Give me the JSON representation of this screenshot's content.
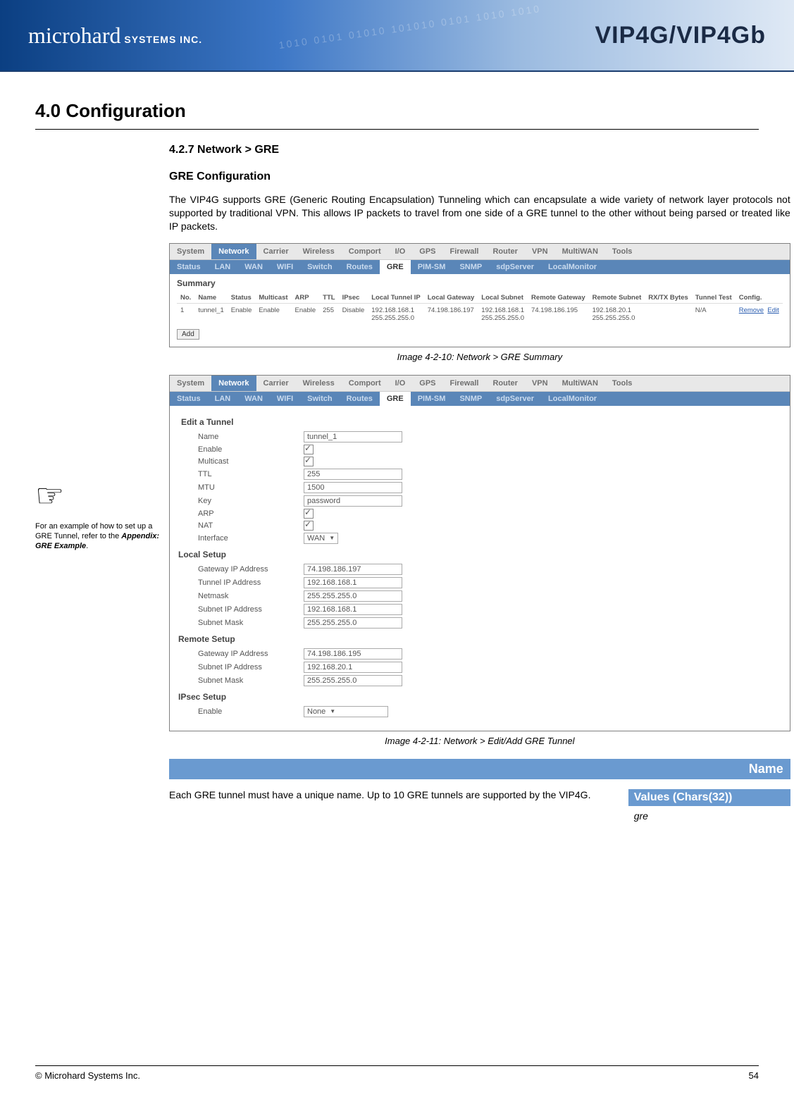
{
  "banner": {
    "brand_main": "microhard",
    "brand_sub": " SYSTEMS INC.",
    "product": "VIP4G/VIP4Gb"
  },
  "section": {
    "number_title": "4.0  Configuration",
    "subsection": "4.2.7 Network > GRE",
    "config_head": "GRE Configuration",
    "intro": "The VIP4G supports GRE (Generic Routing Encapsulation) Tunneling which can encapsulate a wide variety of network layer protocols not supported by traditional VPN. This allows IP packets to travel from one side of a GRE tunnel to the other without being parsed or treated like IP packets."
  },
  "sidenote": {
    "text1": "For an example of how to set up a GRE Tunnel, refer to the ",
    "link": "Appendix: GRE Example",
    "text2": "."
  },
  "tabs_main": [
    "System",
    "Network",
    "Carrier",
    "Wireless",
    "Comport",
    "I/O",
    "GPS",
    "Firewall",
    "Router",
    "VPN",
    "MultiWAN",
    "Tools"
  ],
  "tabs_sub": [
    "Status",
    "LAN",
    "WAN",
    "WIFI",
    "Switch",
    "Routes",
    "GRE",
    "PIM-SM",
    "SNMP",
    "sdpServer",
    "LocalMonitor"
  ],
  "screenshot1": {
    "summary_label": "Summary",
    "headers": [
      "No.",
      "Name",
      "Status",
      "Multicast",
      "ARP",
      "TTL",
      "IPsec",
      "Local Tunnel IP",
      "Local Gateway",
      "Local Subnet",
      "Remote Gateway",
      "Remote Subnet",
      "RX/TX Bytes",
      "Tunnel Test",
      "Config."
    ],
    "row": {
      "no": "1",
      "name": "tunnel_1",
      "status": "Enable",
      "multicast": "Enable",
      "arp": "Enable",
      "ttl": "255",
      "ipsec": "Disable",
      "local_tunnel_ip_top": "192.168.168.1",
      "local_tunnel_ip_bot": "255.255.255.0",
      "local_gateway": "74.198.186.197",
      "local_subnet_top": "192.168.168.1",
      "local_subnet_bot": "255.255.255.0",
      "remote_gateway": "74.198.186.195",
      "remote_subnet_top": "192.168.20.1",
      "remote_subnet_bot": "255.255.255.0",
      "rxtx": "",
      "tunnel_test": "N/A",
      "config_remove": "Remove",
      "config_edit": "Edit"
    },
    "add_btn": "Add",
    "caption": "Image 4-2-10:  Network  > GRE Summary"
  },
  "screenshot2": {
    "edit_head": "Edit a Tunnel",
    "fields": {
      "name_lbl": "Name",
      "name_val": "tunnel_1",
      "enable_lbl": "Enable",
      "multicast_lbl": "Multicast",
      "ttl_lbl": "TTL",
      "ttl_val": "255",
      "mtu_lbl": "MTU",
      "mtu_val": "1500",
      "key_lbl": "Key",
      "key_val": "password",
      "arp_lbl": "ARP",
      "nat_lbl": "NAT",
      "iface_lbl": "Interface",
      "iface_val": "WAN"
    },
    "local_head": "Local Setup",
    "local": {
      "gw_lbl": "Gateway IP Address",
      "gw_val": "74.198.186.197",
      "tip_lbl": "Tunnel IP Address",
      "tip_val": "192.168.168.1",
      "nm_lbl": "Netmask",
      "nm_val": "255.255.255.0",
      "sip_lbl": "Subnet IP Address",
      "sip_val": "192.168.168.1",
      "sm_lbl": "Subnet Mask",
      "sm_val": "255.255.255.0"
    },
    "remote_head": "Remote Setup",
    "remote": {
      "gw_lbl": "Gateway IP Address",
      "gw_val": "74.198.186.195",
      "sip_lbl": "Subnet IP Address",
      "sip_val": "192.168.20.1",
      "sm_lbl": "Subnet Mask",
      "sm_val": "255.255.255.0"
    },
    "ipsec_head": "IPsec Setup",
    "ipsec": {
      "enable_lbl": "Enable",
      "enable_val": "None"
    },
    "caption": "Image 4-2-11:  Network  > Edit/Add GRE Tunnel"
  },
  "param": {
    "name_bar": "Name",
    "desc": "Each GRE tunnel must have a unique name. Up to 10 GRE tunnels are supported by the VIP4G.",
    "values_head": "Values (Chars(32))",
    "values_val": "gre"
  },
  "footer": {
    "copyright": "© Microhard Systems Inc.",
    "page": "54"
  }
}
